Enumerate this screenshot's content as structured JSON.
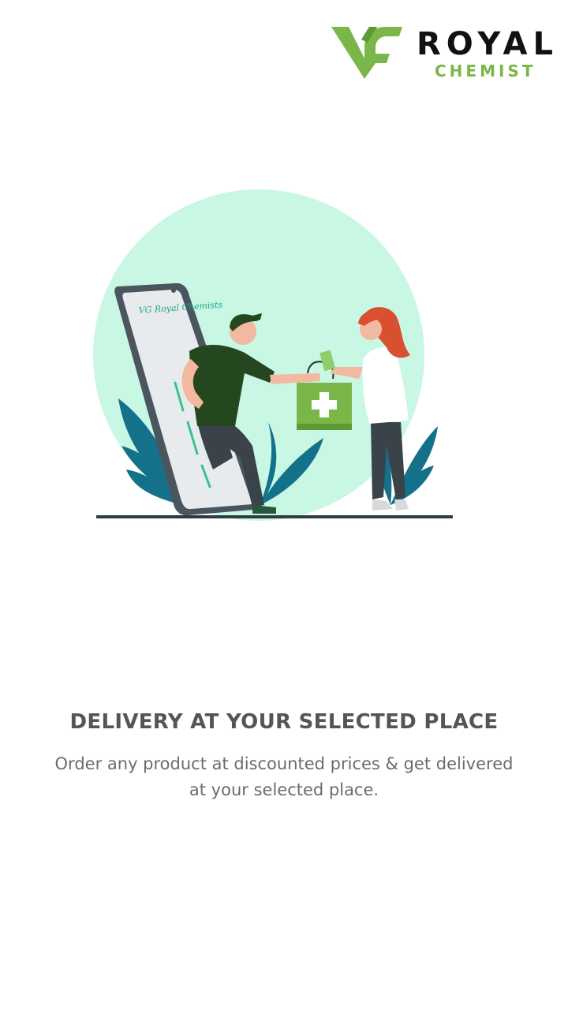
{
  "brand": {
    "name_line1": "ROYAL",
    "name_line2": "CHEMIST",
    "mark_letters": "VG",
    "brand_color": "#7ab648"
  },
  "illustration": {
    "phone_screen_text": "VG Royal Chemists",
    "icon": "delivery-person-handing-medicine-bag-icon",
    "accent_circle_color": "#c8f7e4",
    "bag_color": "#7ab648"
  },
  "onboarding": {
    "title": "DELIVERY AT YOUR SELECTED PLACE",
    "description": "Order any product at discounted prices & get delivered at your selected place."
  }
}
